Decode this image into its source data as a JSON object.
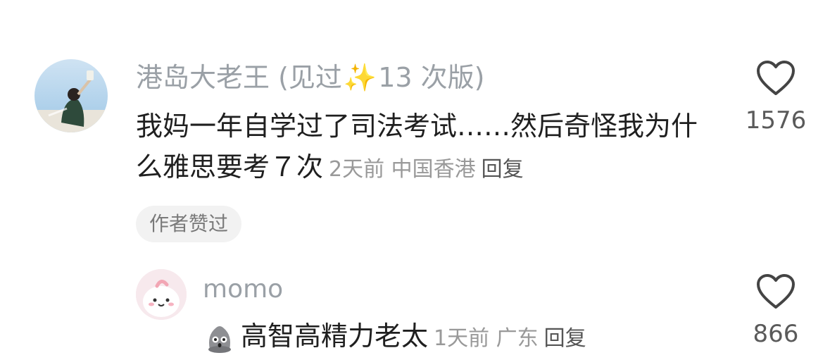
{
  "comment": {
    "author": "港岛大老王 (见过",
    "author_sparkle": "✨",
    "author_suffix": "13 次版)",
    "text": "我妈一年自学过了司法考试……然后奇怪我为什么雅思要考７次",
    "time": "2天前",
    "location": "中国香港",
    "reply_label": "回复",
    "author_liked_badge": "作者赞过",
    "like_count": "1576",
    "icons": {
      "like": "heart-outline-icon",
      "avatar": "user-avatar-photo"
    }
  },
  "reply": {
    "author": "momo",
    "text": "高智高精力老太",
    "time": "1天前",
    "location": "广东",
    "reply_label": "回复",
    "like_count": "866",
    "icons": {
      "like": "heart-outline-icon",
      "emoji": "gray-blob-emoji-icon",
      "avatar": "pink-cartoon-avatar"
    }
  }
}
